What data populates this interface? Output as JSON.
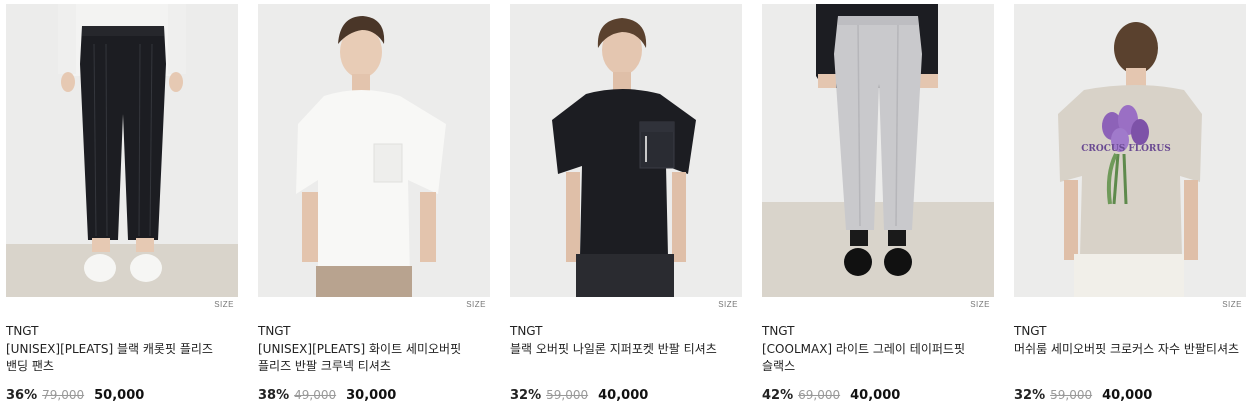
{
  "products": [
    {
      "brand": "TNGT",
      "title": "[UNISEX][PLEATS] 블랙 캐롯핏 플리즈 밴딩 팬츠",
      "discount": "36%",
      "original_price": "79,000",
      "sale_price": "50,000",
      "size_label": "SIZE"
    },
    {
      "brand": "TNGT",
      "title": "[UNISEX][PLEATS] 화이트 세미오버핏 플리즈 반팔 크루넥 티셔츠",
      "discount": "38%",
      "original_price": "49,000",
      "sale_price": "30,000",
      "size_label": "SIZE"
    },
    {
      "brand": "TNGT",
      "title": "블랙 오버핏 나일론 지퍼포켓 반팔 티셔츠",
      "discount": "32%",
      "original_price": "59,000",
      "sale_price": "40,000",
      "size_label": "SIZE"
    },
    {
      "brand": "TNGT",
      "title": "[COOLMAX] 라이트 그레이 테이퍼드핏 슬랙스",
      "discount": "42%",
      "original_price": "69,000",
      "sale_price": "40,000",
      "size_label": "SIZE"
    },
    {
      "brand": "TNGT",
      "title": "머쉬룸 세미오버핏 크로커스 자수 반팔티셔츠",
      "discount": "32%",
      "original_price": "59,000",
      "sale_price": "40,000",
      "size_label": "SIZE"
    }
  ],
  "colors": {
    "wall": "#ececeb",
    "floor": "#d9d4cb",
    "black_garment": "#1c1d22",
    "white_garment": "#f6f6f4",
    "grey_slacks": "#c9c9cc",
    "beige_tee": "#d8d2c8",
    "print_purple": "#8d62b8"
  },
  "print_text": "CROCUS FLORUS"
}
